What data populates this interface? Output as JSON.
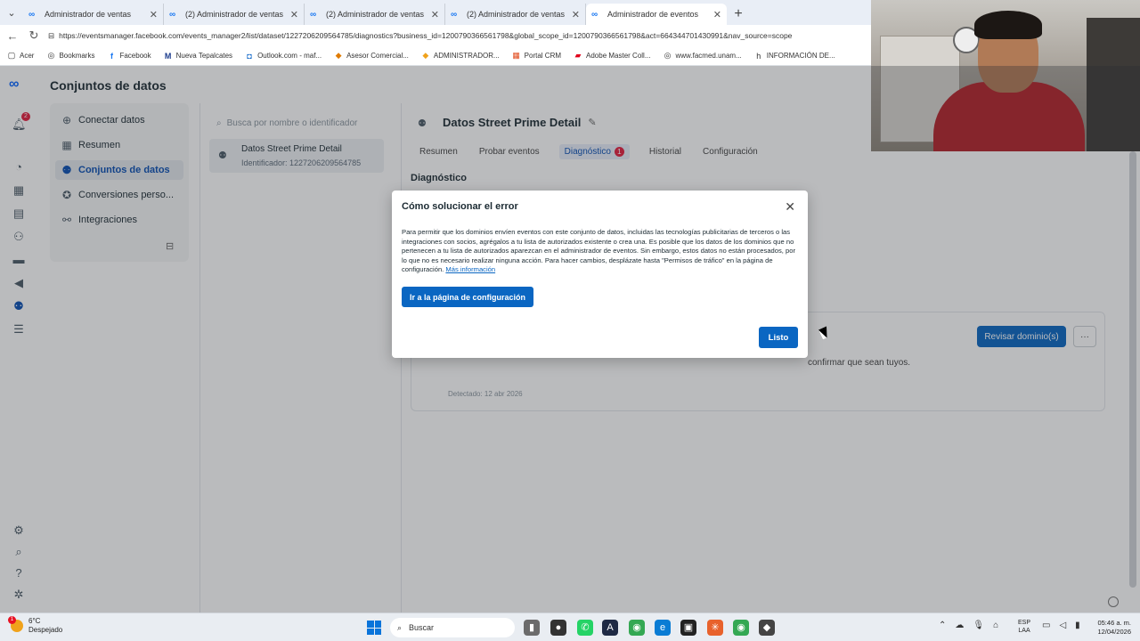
{
  "browser": {
    "tabs": [
      {
        "title": "Administrador de ventas",
        "active": false
      },
      {
        "title": "(2) Administrador de ventas",
        "active": false
      },
      {
        "title": "(2) Administrador de ventas",
        "active": false
      },
      {
        "title": "(2) Administrador de ventas",
        "active": false
      },
      {
        "title": "Administrador de eventos",
        "active": true
      }
    ],
    "url": "https://eventsmanager.facebook.com/events_manager2/list/dataset/1227206209564785/diagnostics?business_id=1200790366561798&global_scope_id=1200790366561798&act=664344701430991&nav_source=scope",
    "bookmarks": [
      "Acer",
      "Bookmarks",
      "Facebook",
      "Nueva Tepalcates",
      "Outlook.com - maf...",
      "Asesor Comercial...",
      "ADMINISTRADOR...",
      "Portal CRM",
      "Adobe Master Coll...",
      "www.facmed.unam...",
      "INFORMACIÓN DE..."
    ]
  },
  "app": {
    "title": "Conjuntos de datos",
    "notification_count": "2",
    "nav": [
      {
        "label": "Conectar datos",
        "icon": "plus-circle-icon"
      },
      {
        "label": "Resumen",
        "icon": "table-icon"
      },
      {
        "label": "Conjuntos de datos",
        "icon": "people-icon",
        "active": true
      },
      {
        "label": "Conversiones perso...",
        "icon": "star-badge-icon"
      },
      {
        "label": "Integraciones",
        "icon": "link-icon"
      }
    ],
    "search_placeholder": "Busca por nombre o identificador",
    "dataset": {
      "name": "Datos Street Prime Detail",
      "identifier": "Identificador: 1227206209564785"
    }
  },
  "main": {
    "title": "Datos Street Prime Detail",
    "tabs": [
      {
        "label": "Resumen"
      },
      {
        "label": "Probar eventos"
      },
      {
        "label": "Diagnóstico",
        "badge": "1",
        "selected": true
      },
      {
        "label": "Historial"
      },
      {
        "label": "Configuración"
      }
    ],
    "section_heading": "Diagnóstico",
    "review_button": "Revisar dominio(s)",
    "more_button": "···",
    "issue_text": "confirmar que sean tuyos.",
    "issue_date": "Detectado: 12 abr 2026"
  },
  "modal": {
    "title": "Cómo solucionar el error",
    "body": "Para permitir que los dominios envíen eventos con este conjunto de datos, incluidas las tecnologías publicitarias de terceros o las integraciones con socios, agrégalos a tu lista de autorizados existente o crea una. Es posible que los datos de los dominios que no pertenecen a tu lista de autorizados aparezcan en el administrador de eventos. Sin embargo, estos datos no están procesados, por lo que no es necesario realizar ninguna acción. Para hacer cambios, desplázate hasta \"Permisos de tráfico\" en la página de configuración.",
    "link": "Más información",
    "config_button": "Ir a la página de configuración",
    "done_button": "Listo"
  },
  "taskbar": {
    "weather_temp": "6°C",
    "weather_desc": "Despejado",
    "weather_badge": "1",
    "search_label": "Buscar",
    "lang_line1": "ESP",
    "lang_line2": "LAA",
    "time": "05:46 a. m.",
    "date": "12/04/2026"
  },
  "colors": {
    "accent": "#0a66c2",
    "badge": "#e41e3f",
    "meta_blue": "#0866ff"
  }
}
